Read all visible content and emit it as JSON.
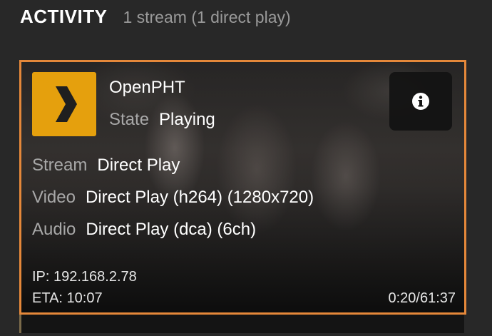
{
  "header": {
    "title": "ACTIVITY",
    "subtitle": "1 stream (1 direct play)"
  },
  "session": {
    "player_name": "OpenPHT",
    "state_label": "State",
    "state_value": "Playing",
    "stream_label": "Stream",
    "stream_value": "Direct Play",
    "video_label": "Video",
    "video_value": "Direct Play (h264) (1280x720)",
    "audio_label": "Audio",
    "audio_value": "Direct Play (dca) (6ch)",
    "ip": "IP: 192.168.2.78",
    "eta": "ETA: 10:07",
    "progress_time": "0:20/61:37",
    "progress_fraction": 0.005,
    "icons": {
      "player": "plex-chevron-icon",
      "sync": "sync-icon",
      "info": "info-icon"
    }
  },
  "colors": {
    "accent": "#e5883a",
    "plex_yellow": "#e5a00d",
    "background": "#282828"
  }
}
